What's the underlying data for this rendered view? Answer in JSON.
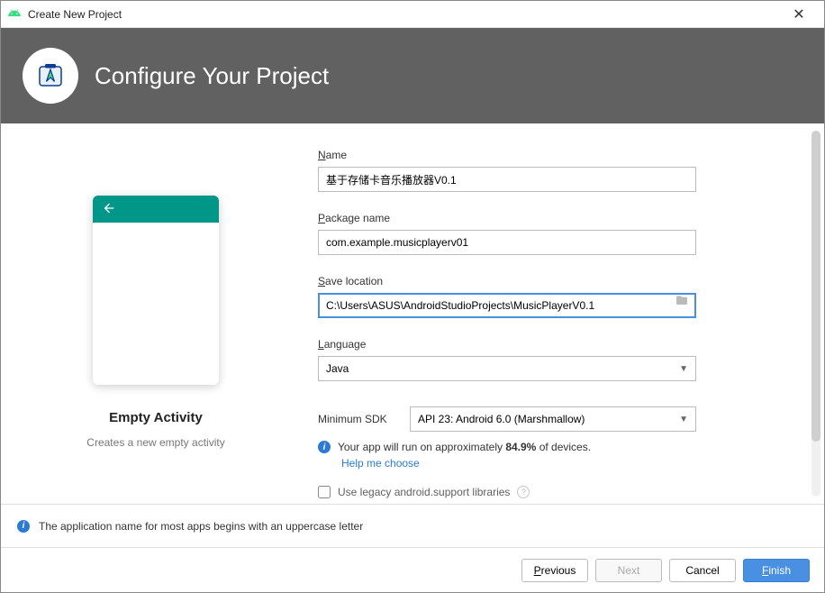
{
  "titlebar": {
    "title": "Create New Project"
  },
  "header": {
    "title": "Configure Your Project"
  },
  "form": {
    "name_label_prefix": "N",
    "name_label_rest": "ame",
    "name_value": "基于存储卡音乐播放器V0.1",
    "package_label_prefix": "P",
    "package_label_rest": "ackage name",
    "package_value": "com.example.musicplayerv01",
    "save_label_prefix": "S",
    "save_label_rest": "ave location",
    "save_value": "C:\\Users\\ASUS\\AndroidStudioProjects\\MusicPlayerV0.1",
    "language_label_prefix": "L",
    "language_label_rest": "anguage",
    "language_value": "Java",
    "min_sdk_label": "Minimum SDK",
    "min_sdk_value": "API 23: Android 6.0 (Marshmallow)",
    "info_text_prefix": "Your app will run on approximately ",
    "info_text_percent": "84.9%",
    "info_text_suffix": " of devices.",
    "help_link": "Help me choose",
    "legacy_label": "Use legacy android.support libraries"
  },
  "preview": {
    "title": "Empty Activity",
    "subtitle": "Creates a new empty activity"
  },
  "status": {
    "message": "The application name for most apps begins with an uppercase letter"
  },
  "footer": {
    "previous_prefix": "P",
    "previous_rest": "revious",
    "next": "Next",
    "cancel": "Cancel",
    "finish_prefix": "F",
    "finish_rest": "inish"
  }
}
